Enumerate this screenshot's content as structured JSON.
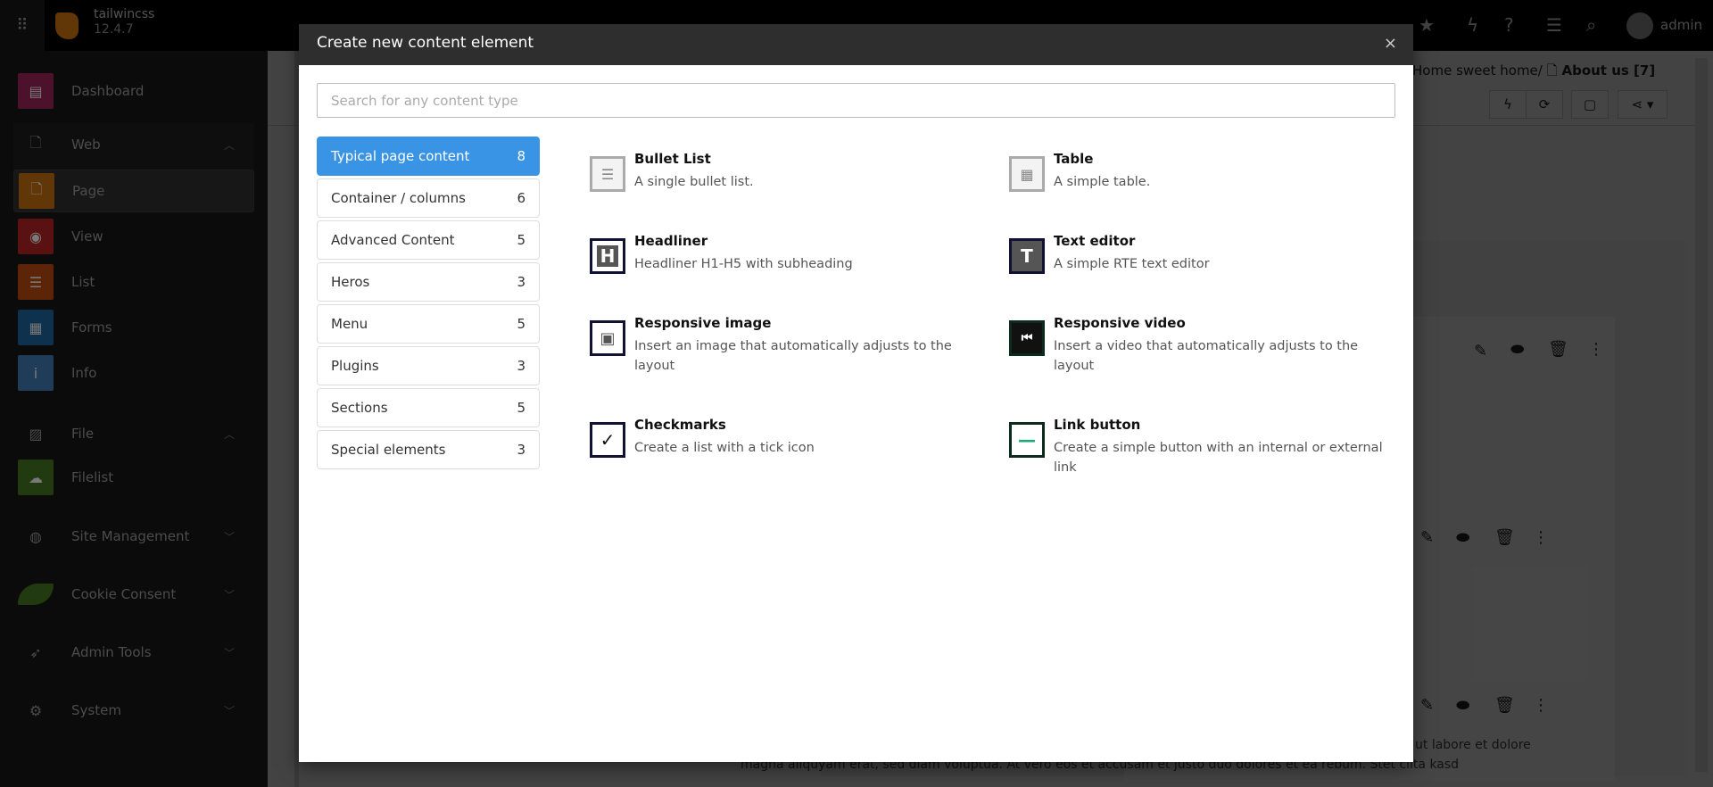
{
  "topbar": {
    "site_name": "tailwincss",
    "version": "12.4.7",
    "user": "admin",
    "icons": [
      "star-icon",
      "bolt-icon",
      "help-icon",
      "list-icon",
      "search-icon"
    ]
  },
  "sidebar": {
    "items": [
      {
        "label": "Dashboard",
        "icon": "dashboard-icon",
        "color": "#8a1f4f"
      },
      {
        "label": "Web",
        "icon": "page-icon",
        "group": true,
        "expanded": true
      },
      {
        "label": "Page",
        "icon": "page-icon",
        "color": "#b3650f",
        "active": true
      },
      {
        "label": "View",
        "icon": "eye-icon",
        "color": "#a51f1f"
      },
      {
        "label": "List",
        "icon": "list-icon",
        "color": "#a84410"
      },
      {
        "label": "Forms",
        "icon": "form-icon",
        "color": "#1b5a8c"
      },
      {
        "label": "Info",
        "icon": "info-icon",
        "color": "#3a6fa3"
      },
      {
        "label": "File",
        "icon": "image-icon",
        "group": true,
        "expanded": true
      },
      {
        "label": "Filelist",
        "icon": "cloud-icon",
        "color": "#3c6a1e"
      },
      {
        "label": "Site Management",
        "icon": "globe-icon",
        "group": true,
        "expanded": false
      },
      {
        "label": "Cookie Consent",
        "icon": "leaf-icon",
        "group": true,
        "expanded": false
      },
      {
        "label": "Admin Tools",
        "icon": "rocket-icon",
        "group": true,
        "expanded": false
      },
      {
        "label": "System",
        "icon": "gear-icon",
        "group": true,
        "expanded": false
      }
    ]
  },
  "content": {
    "breadcrumb_parent": "Home sweet home/",
    "breadcrumb_current": "About us [7]",
    "text_line1": "ut labore et dolore",
    "text_line2": "magna aliquyam erat, sed diam voluptua. At vero eos et accusam et justo duo dolores et ea rebum. Stet clita kasd"
  },
  "modal": {
    "title": "Create new content element",
    "close": "×",
    "search_placeholder": "Search for any content type",
    "search_value": "",
    "categories": [
      {
        "label": "Typical page content",
        "count": "8",
        "active": true
      },
      {
        "label": "Container / columns",
        "count": "6"
      },
      {
        "label": "Advanced Content",
        "count": "5"
      },
      {
        "label": "Heros",
        "count": "3"
      },
      {
        "label": "Menu",
        "count": "5"
      },
      {
        "label": "Plugins",
        "count": "3"
      },
      {
        "label": "Sections",
        "count": "5"
      },
      {
        "label": "Special elements",
        "count": "3"
      }
    ],
    "elements": [
      {
        "title": "Bullet List",
        "desc": "A single bullet list.",
        "icon": "bullet-list-icon"
      },
      {
        "title": "Table",
        "desc": "A simple table.",
        "icon": "table-icon"
      },
      {
        "title": "Headliner",
        "desc": "Headliner H1-H5 with subheading",
        "icon": "headliner-icon"
      },
      {
        "title": "Text editor",
        "desc": "A simple RTE text editor",
        "icon": "text-editor-icon"
      },
      {
        "title": "Responsive image",
        "desc": "Insert an image that automatically adjusts to the layout",
        "icon": "image-icon"
      },
      {
        "title": "Responsive video",
        "desc": "Insert a video that automatically adjusts to the layout",
        "icon": "video-icon"
      },
      {
        "title": "Checkmarks",
        "desc": "Create a list with a tick icon",
        "icon": "checkmark-icon"
      },
      {
        "title": "Link button",
        "desc": "Create a simple button with an internal or external link",
        "icon": "link-button-icon"
      }
    ]
  },
  "colors": {
    "accent": "#3a94e6",
    "modal_header": "#2e2e2e",
    "sidebar": "#141414"
  }
}
